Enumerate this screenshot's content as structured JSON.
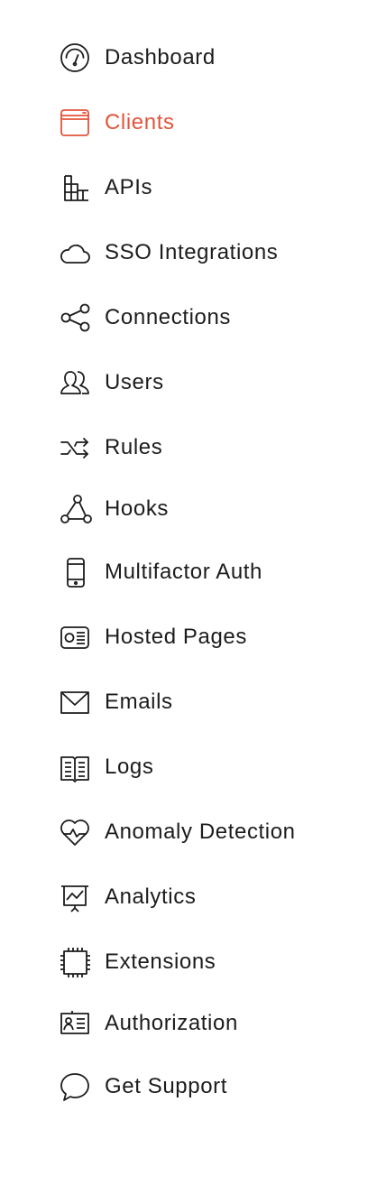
{
  "colors": {
    "text": "#1c1c1c",
    "active": "#e2543b",
    "background": "#ffffff"
  },
  "sidebar": {
    "items": [
      {
        "label": "Dashboard",
        "icon": "gauge-icon"
      },
      {
        "label": "Clients",
        "icon": "window-stack-icon",
        "active": true
      },
      {
        "label": "APIs",
        "icon": "building-blocks-icon"
      },
      {
        "label": "SSO Integrations",
        "icon": "cloud-icon"
      },
      {
        "label": "Connections",
        "icon": "share-nodes-icon"
      },
      {
        "label": "Users",
        "icon": "users-icon"
      },
      {
        "label": "Rules",
        "icon": "shuffle-icon"
      },
      {
        "label": "Hooks",
        "icon": "triangle-nodes-icon"
      },
      {
        "label": "Multifactor Auth",
        "icon": "mobile-phone-icon"
      },
      {
        "label": "Hosted Pages",
        "icon": "id-card-icon"
      },
      {
        "label": "Emails",
        "icon": "envelope-icon"
      },
      {
        "label": "Logs",
        "icon": "open-book-icon"
      },
      {
        "label": "Anomaly Detection",
        "icon": "heart-pulse-icon"
      },
      {
        "label": "Analytics",
        "icon": "presentation-chart-icon"
      },
      {
        "label": "Extensions",
        "icon": "chip-icon"
      },
      {
        "label": "Authorization",
        "icon": "badge-list-icon"
      },
      {
        "label": "Get Support",
        "icon": "chat-bubble-icon"
      }
    ]
  }
}
